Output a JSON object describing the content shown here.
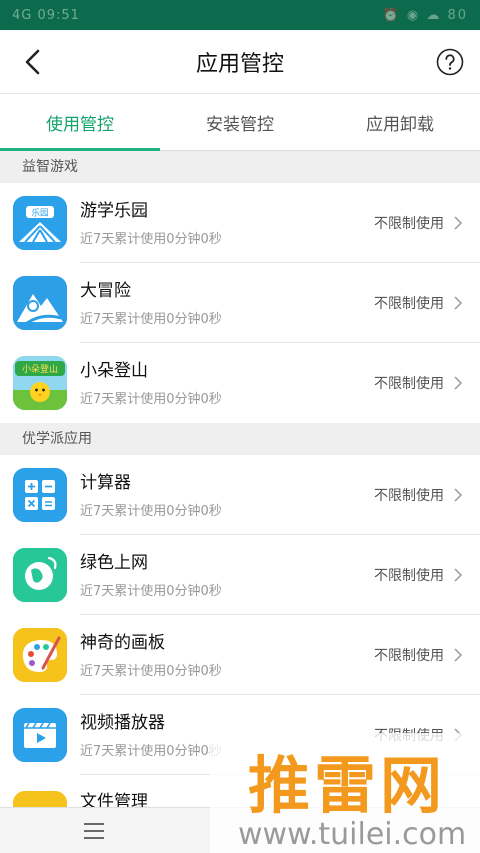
{
  "status_bar": {
    "left": "4G 09:51",
    "right": "⏰ ◉ ☁ 80"
  },
  "header": {
    "title": "应用管控"
  },
  "tabs": [
    {
      "label": "使用管控",
      "active": true
    },
    {
      "label": "安装管控",
      "active": false
    },
    {
      "label": "应用卸载",
      "active": false
    }
  ],
  "sections": [
    {
      "title": "益智游戏",
      "apps": [
        {
          "name": "游学乐园",
          "usage": "近7天累计使用0分钟0秒",
          "status": "不限制使用",
          "icon": "park-icon",
          "icon_label": "乐园"
        },
        {
          "name": "大冒险",
          "usage": "近7天累计使用0分钟0秒",
          "status": "不限制使用",
          "icon": "adventure-icon"
        },
        {
          "name": "小朵登山",
          "usage": "近7天累计使用0分钟0秒",
          "status": "不限制使用",
          "icon": "climb-icon",
          "icon_label": "小朵登山"
        }
      ]
    },
    {
      "title": "优学派应用",
      "apps": [
        {
          "name": "计算器",
          "usage": "近7天累计使用0分钟0秒",
          "status": "不限制使用",
          "icon": "calculator-icon"
        },
        {
          "name": "绿色上网",
          "usage": "近7天累计使用0分钟0秒",
          "status": "不限制使用",
          "icon": "globe-icon"
        },
        {
          "name": "神奇的画板",
          "usage": "近7天累计使用0分钟0秒",
          "status": "不限制使用",
          "icon": "palette-icon"
        },
        {
          "name": "视频播放器",
          "usage": "近7天累计使用0分钟0秒",
          "status": "不限制使用",
          "icon": "video-player-icon"
        },
        {
          "name": "文件管理",
          "usage": "",
          "status": "",
          "icon": "folder-icon"
        }
      ]
    }
  ],
  "watermark": {
    "main": "推雷网",
    "url": "www.tuilei.com"
  },
  "colors": {
    "status_bar": "#0b6b4c",
    "accent": "#13a36b",
    "icon_blue": "#2aa1e8",
    "icon_green": "#28c79a",
    "icon_yellow": "#f6c21c"
  }
}
